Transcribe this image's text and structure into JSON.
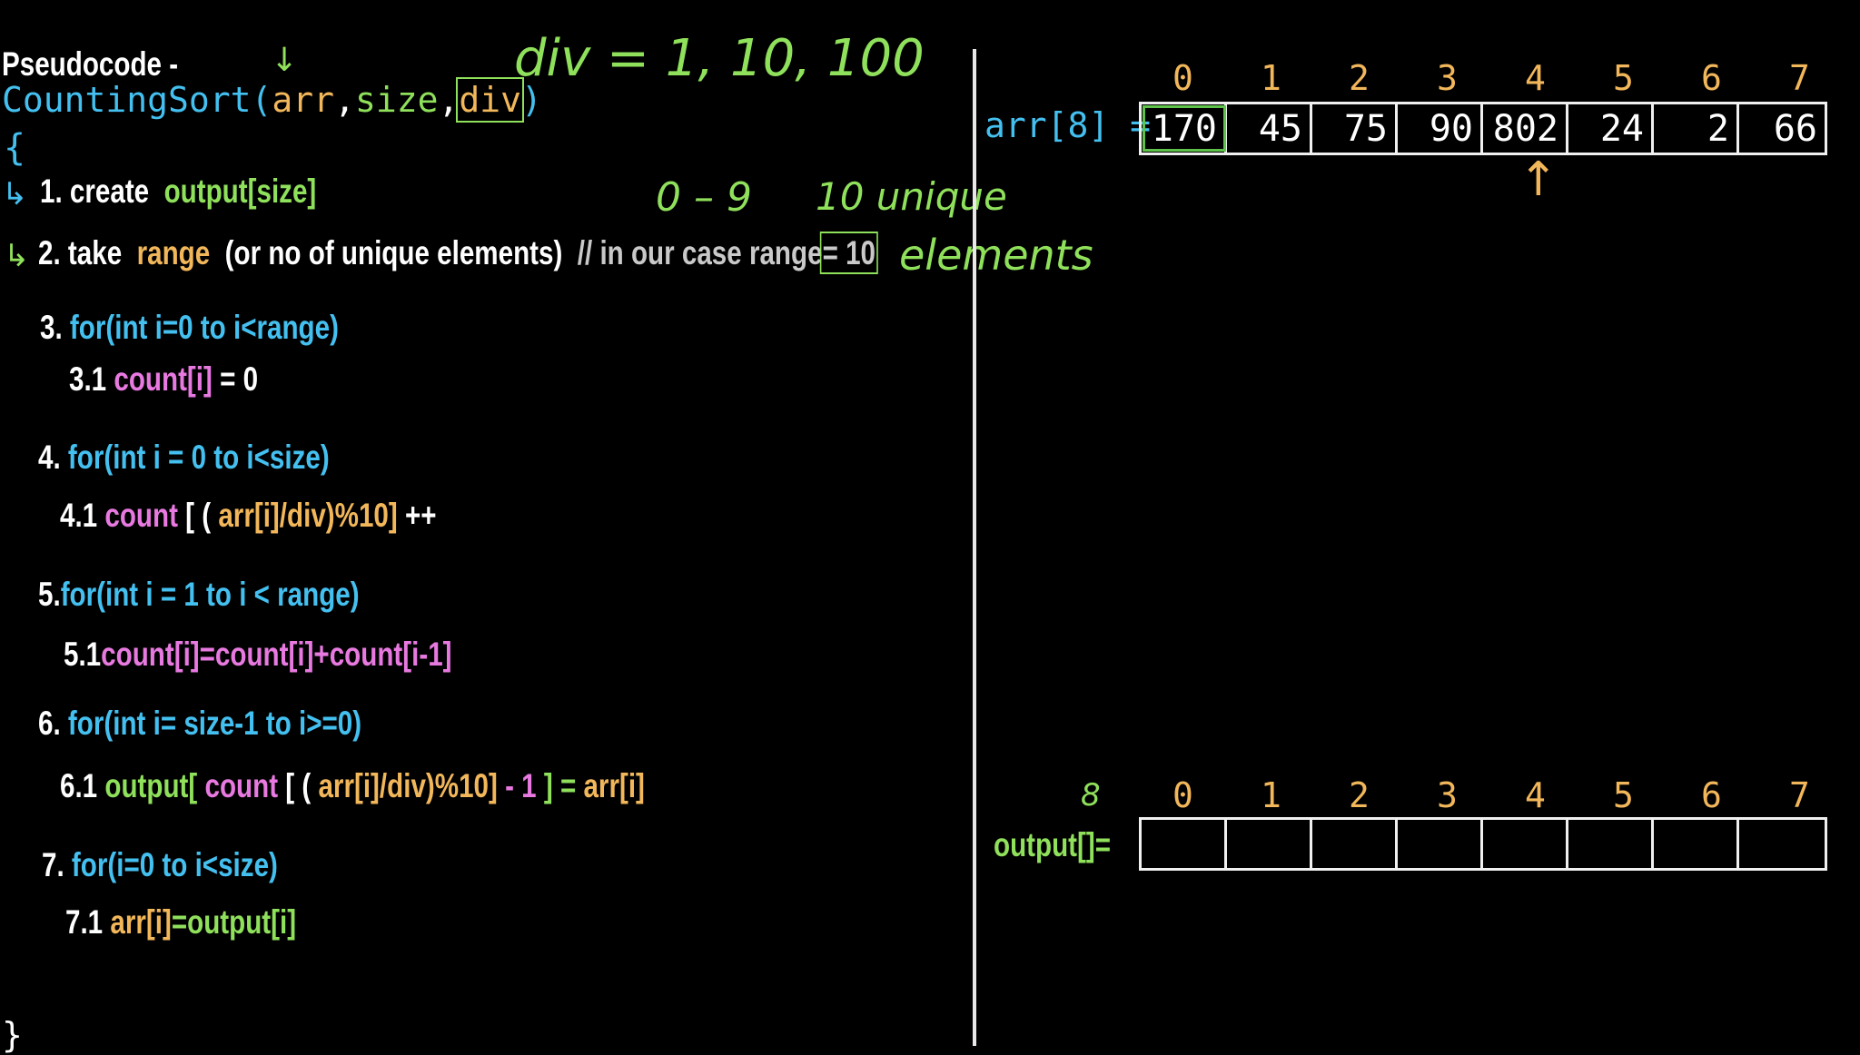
{
  "pseudocode": {
    "heading": "Pseudocode -",
    "func_name": "CountingSort(",
    "param_arr": "arr",
    "comma1": ",",
    "param_size": "size",
    "comma2": ",",
    "param_div": "div",
    "close_paren": ")",
    "open_brace": "{",
    "close_brace": "}",
    "steps": {
      "s1_num": "1. create",
      "s1_code": "output[size]",
      "s2_num": "2. take",
      "s2_kw": "range",
      "s2_rest": "(or no of unique elements)",
      "s2_comment": "// in our case range",
      "s2_value": "= 10",
      "s3_num": "3.",
      "s3_code": "for(int i=0 to i<range)",
      "s31_num": "3.1",
      "s31_code": "count[i]",
      "s31_rest": "= 0",
      "s4_num": "4.",
      "s4_code": "for(int i = 0 to i<size)",
      "s41_num": "4.1",
      "s41_a": "count",
      "s41_b": "[ (",
      "s41_c": "arr[i]",
      "s41_d": "/div)%10]",
      "s41_e": "++",
      "s5_num": "5.",
      "s5_code": "for(int i = 1 to i < range)",
      "s51_num": "5.1",
      "s51_code": "count[i]=count[i]+count[i-1]",
      "s6_num": "6.",
      "s6_code": "for(int i= size-1 to i>=0)",
      "s61_num": "6.1",
      "s61_a": "output[",
      "s61_b": "count",
      "s61_c": "[ (",
      "s61_d": "arr[i]",
      "s61_e": "/div)%10]",
      "s61_f": "- 1",
      "s61_g": "] =",
      "s61_h": "arr[i]",
      "s7_num": "7.",
      "s7_code": "for(i=0 to i<size)",
      "s71_num": "7.1",
      "s71_a": "arr[i]",
      "s71_b": "=output[i]"
    }
  },
  "annotations": {
    "div_values": "div = 1, 10, 100",
    "down_arrow": "↓",
    "range_digits": "0 – 9",
    "unique_note": "10 unique",
    "elements_note": "elements",
    "up_arrow": "↑",
    "output_size_note": "8"
  },
  "arr_table": {
    "label": "arr[8] =",
    "indices": [
      "0",
      "1",
      "2",
      "3",
      "4",
      "5",
      "6",
      "7"
    ],
    "values": [
      "170",
      "45",
      "75",
      "90",
      "802",
      "24",
      "2",
      "66"
    ],
    "highlighted_index": 0
  },
  "output_table": {
    "label": "output[]=",
    "indices": [
      "0",
      "1",
      "2",
      "3",
      "4",
      "5",
      "6",
      "7"
    ],
    "values": [
      "",
      "",
      "",
      "",
      "",
      "",
      "",
      ""
    ]
  },
  "colors": {
    "background": "#000000",
    "white": "#ffffff",
    "green": "#8fe05b",
    "orange": "#f2b75a",
    "cyan": "#44c0f0",
    "pink": "#e879e0",
    "gray": "#c9c9c9"
  }
}
